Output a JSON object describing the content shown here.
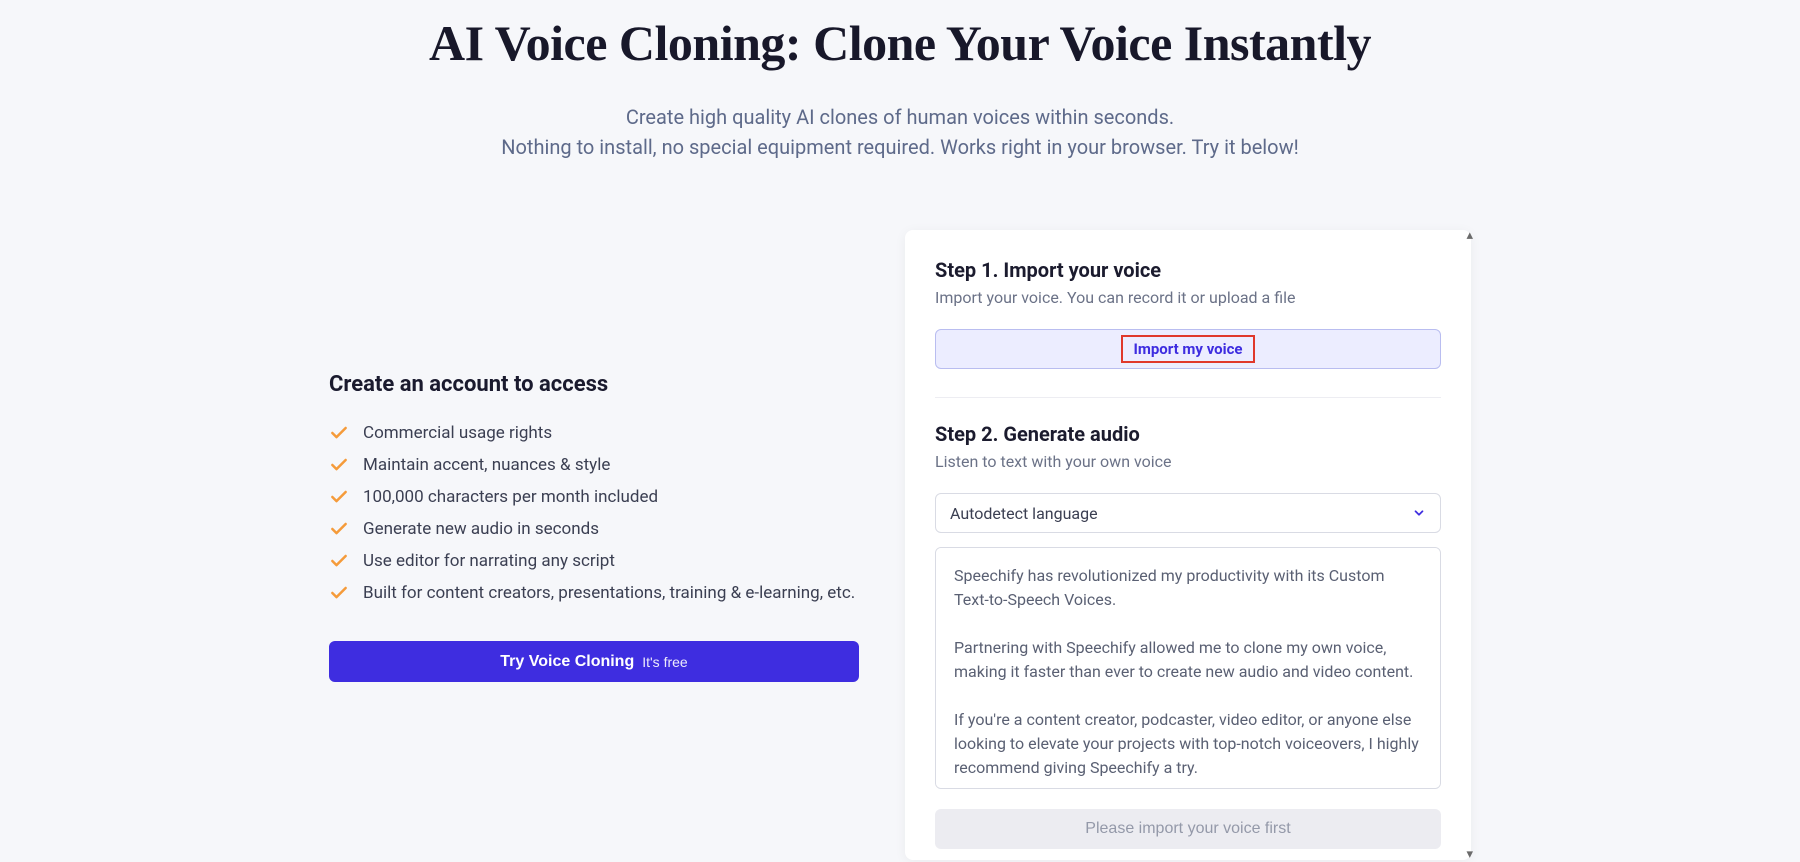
{
  "hero": {
    "title": "AI Voice Cloning: Clone Your Voice Instantly",
    "subtitle_line1": "Create high quality AI clones of human voices within seconds.",
    "subtitle_line2": "Nothing to install, no special equipment required. Works right in your browser. Try it below!"
  },
  "left": {
    "heading": "Create an account to access",
    "features": [
      "Commercial usage rights",
      "Maintain accent, nuances & style",
      "100,000 characters per month included",
      "Generate new audio in seconds",
      "Use editor for narrating any script",
      "Built for content creators, presentations, training & e-learning, etc."
    ],
    "cta_main": "Try Voice Cloning",
    "cta_sub": "It's free"
  },
  "panel": {
    "step1_title": "Step 1. Import your voice",
    "step1_sub": "Import your voice. You can record it or upload a file",
    "import_label": "Import my voice",
    "step2_title": "Step 2. Generate audio",
    "step2_sub": "Listen to text with your own voice",
    "language_selected": "Autodetect language",
    "textarea_value": "Speechify has revolutionized my productivity with its Custom Text-to-Speech Voices.\n\nPartnering with Speechify allowed me to clone my own voice, making it faster than ever to create new audio and video content.\n\nIf you're a content creator, podcaster, video editor, or anyone else looking to elevate your projects with top-notch voiceovers, I highly recommend giving Speechify a try.",
    "generate_disabled_label": "Please import your voice first"
  }
}
